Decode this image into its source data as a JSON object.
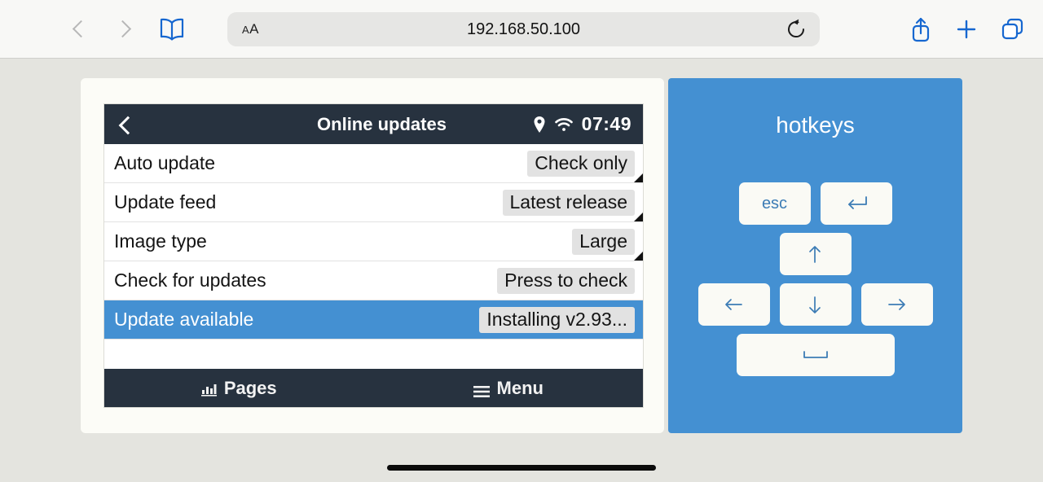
{
  "browser": {
    "back_icon": "chevron-left-icon",
    "forward_icon": "chevron-right-icon",
    "bookmarks_icon": "book-icon",
    "text_size_label": "AA",
    "url": "192.168.50.100",
    "reload_icon": "reload-icon",
    "share_icon": "share-icon",
    "new_tab_icon": "plus-icon",
    "tabs_icon": "tabs-icon"
  },
  "device": {
    "header": {
      "back_icon": "chevron-left-icon",
      "title": "Online updates",
      "gps_icon": "location-pin-icon",
      "wifi_icon": "wifi-icon",
      "clock": "07:49"
    },
    "rows": [
      {
        "label": "Auto update",
        "value": "Check only",
        "marker": true,
        "selected": false
      },
      {
        "label": "Update feed",
        "value": "Latest release",
        "marker": true,
        "selected": false
      },
      {
        "label": "Image type",
        "value": "Large",
        "marker": true,
        "selected": false
      },
      {
        "label": "Check for updates",
        "value": "Press to check",
        "marker": false,
        "selected": false
      },
      {
        "label": "Update available",
        "value": "Installing v2.93...",
        "marker": false,
        "selected": true
      }
    ],
    "footer": {
      "pages_icon": "bar-chart-icon",
      "pages_label": "Pages",
      "menu_icon": "hamburger-menu-icon",
      "menu_label": "Menu"
    }
  },
  "hotkeys": {
    "title": "hotkeys",
    "keys": [
      {
        "name": "esc-key",
        "label": "esc",
        "glyph": "text",
        "wide": false
      },
      {
        "name": "enter-key",
        "label": "",
        "glyph": "enter",
        "wide": false
      },
      {
        "name": "arrow-up-key",
        "label": "",
        "glyph": "up",
        "wide": false
      },
      {
        "name": "arrow-left-key",
        "label": "",
        "glyph": "left",
        "wide": false
      },
      {
        "name": "arrow-down-key",
        "label": "",
        "glyph": "down",
        "wide": false
      },
      {
        "name": "arrow-right-key",
        "label": "",
        "glyph": "right",
        "wide": false
      },
      {
        "name": "space-key",
        "label": "",
        "glyph": "space",
        "wide": true
      }
    ]
  },
  "colors": {
    "accent_blue": "#4490d2",
    "header_navy": "#27323f",
    "page_bg": "#e4e4df",
    "card_bg": "#fcfcf7",
    "chip_gray": "#e2e2e2"
  }
}
